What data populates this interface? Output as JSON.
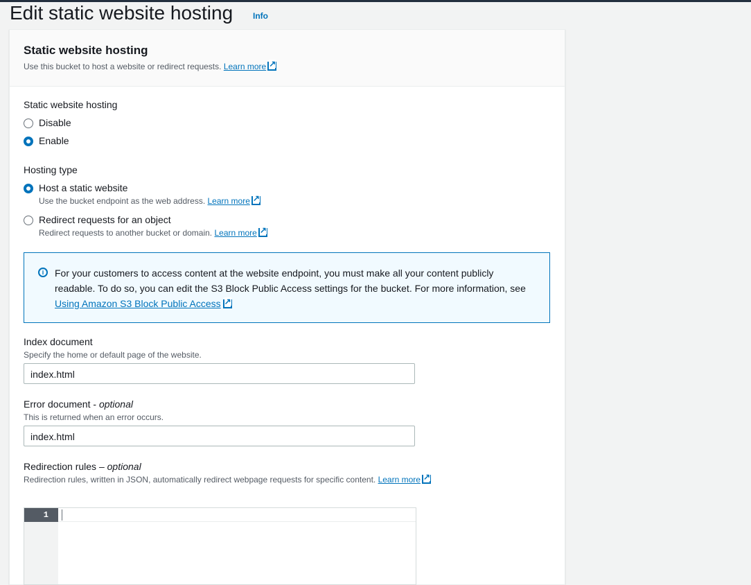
{
  "page": {
    "title": "Edit static website hosting",
    "info_link": "Info"
  },
  "panel": {
    "title": "Static website hosting",
    "description": "Use this bucket to host a website or redirect requests.",
    "learn_more": "Learn more"
  },
  "hosting": {
    "label": "Static website hosting",
    "options": [
      {
        "label": "Disable",
        "checked": false
      },
      {
        "label": "Enable",
        "checked": true
      }
    ]
  },
  "hosting_type": {
    "label": "Hosting type",
    "options": [
      {
        "label": "Host a static website",
        "description": "Use the bucket endpoint as the web address.",
        "learn_more": "Learn more",
        "checked": true
      },
      {
        "label": "Redirect requests for an object",
        "description": "Redirect requests to another bucket or domain.",
        "learn_more": "Learn more",
        "checked": false
      }
    ]
  },
  "alert": {
    "text": "For your customers to access content at the website endpoint, you must make all your content publicly readable. To do so, you can edit the S3 Block Public Access settings for the bucket. For more information, see",
    "link": "Using Amazon S3 Block Public Access"
  },
  "index_document": {
    "label": "Index document",
    "description": "Specify the home or default page of the website.",
    "value": "index.html"
  },
  "error_document": {
    "label": "Error document",
    "optional": "optional",
    "separator": " - ",
    "description": "This is returned when an error occurs.",
    "value": "index.html"
  },
  "redirection_rules": {
    "label": "Redirection rules",
    "optional": "optional",
    "separator": " – ",
    "description": "Redirection rules, written in JSON, automatically redirect webpage requests for specific content.",
    "learn_more": "Learn more",
    "line_number": "1"
  },
  "colors": {
    "accent": "#0073bb",
    "alert_bg": "#f1faff",
    "text": "#16191f"
  }
}
